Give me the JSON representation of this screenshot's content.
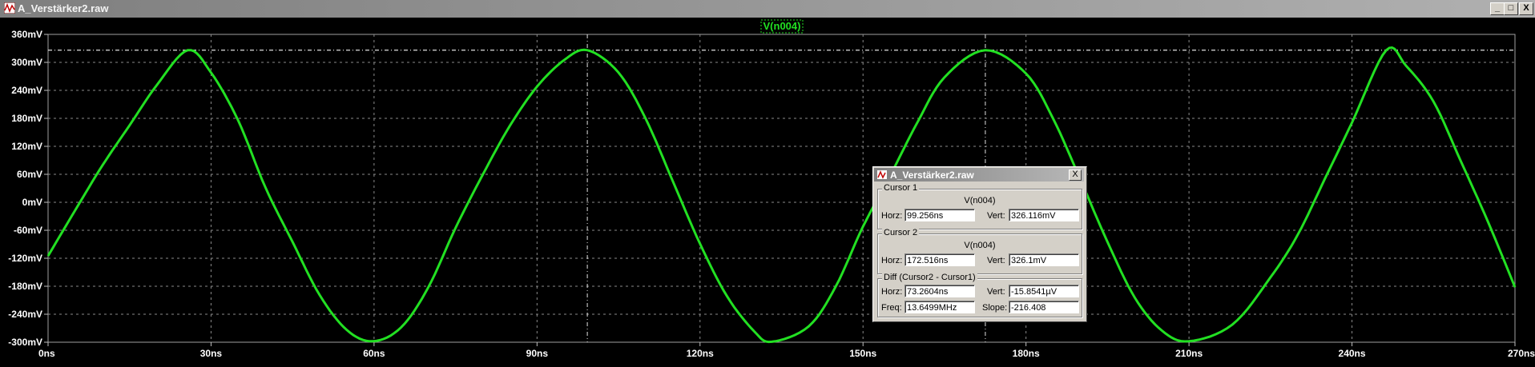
{
  "window": {
    "title": "A_Verstärker2.raw",
    "min_label": "_",
    "max_label": "□",
    "close_label": "X"
  },
  "chart_data": {
    "type": "line",
    "trace_label": "V(n004)",
    "trace_color": "#22e022",
    "x_unit": "ns",
    "y_unit": "mV",
    "xlim": [
      0,
      270
    ],
    "ylim": [
      -300,
      360
    ],
    "x_ticks": [
      "0ns",
      "30ns",
      "60ns",
      "90ns",
      "120ns",
      "150ns",
      "180ns",
      "210ns",
      "240ns",
      "270ns"
    ],
    "x_tick_values": [
      0,
      30,
      60,
      90,
      120,
      150,
      180,
      210,
      240,
      270
    ],
    "y_ticks": [
      "360mV",
      "300mV",
      "240mV",
      "180mV",
      "120mV",
      "60mV",
      "0mV",
      "-60mV",
      "-120mV",
      "-180mV",
      "-240mV",
      "-300mV"
    ],
    "y_tick_values": [
      360,
      300,
      240,
      180,
      120,
      60,
      0,
      -60,
      -120,
      -180,
      -240,
      -300
    ],
    "series": [
      {
        "name": "V(n004)",
        "x": [
          0,
          5,
          10,
          15,
          20,
          25.7,
          30,
          35,
          40,
          45,
          50,
          55,
          59.8,
          65,
          70,
          75,
          80,
          85,
          90,
          95,
          99.3,
          105,
          110,
          115,
          120,
          125,
          130,
          133.2,
          140,
          145,
          150,
          155,
          160,
          165,
          172.5,
          180,
          185,
          190,
          195,
          200,
          205,
          210,
          218,
          225,
          230,
          235,
          240,
          246.3,
          250,
          255,
          260,
          265,
          270
        ],
        "y": [
          -115,
          -17,
          79,
          165,
          251,
          326,
          278,
          175,
          32,
          -85,
          -199,
          -274,
          -298,
          -268,
          -182,
          -55,
          59,
          164,
          248,
          305,
          326,
          278,
          179,
          45,
          -89,
          -202,
          -277,
          -299,
          -266,
          -180,
          -52,
          57,
          171,
          268,
          326,
          276,
          179,
          49,
          -85,
          -204,
          -275,
          -298,
          -262,
          -161,
          -70,
          50,
          171,
          326,
          292,
          216,
          89,
          -41,
          -182
        ]
      }
    ],
    "cursor1": {
      "x": 99.256,
      "y": 326.116
    },
    "cursor2": {
      "x": 172.516,
      "y": 326.1
    },
    "grid": true
  },
  "cursor_dialog": {
    "title": "A_Verstärker2.raw",
    "close_label": "X",
    "cursor1": {
      "group_label": "Cursor 1",
      "trace": "V(n004)",
      "horz_label": "Horz:",
      "horz": "99.256ns",
      "vert_label": "Vert:",
      "vert": "326.116mV"
    },
    "cursor2": {
      "group_label": "Cursor 2",
      "trace": "V(n004)",
      "horz_label": "Horz:",
      "horz": "172.516ns",
      "vert_label": "Vert:",
      "vert": "326.1mV"
    },
    "diff": {
      "group_label": "Diff (Cursor2 - Cursor1)",
      "horz_label": "Horz:",
      "horz": "73.2604ns",
      "vert_label": "Vert:",
      "vert": "-15.8541µV",
      "freq_label": "Freq:",
      "freq": "13.6499MHz",
      "slope_label": "Slope:",
      "slope": "-216.408"
    }
  }
}
